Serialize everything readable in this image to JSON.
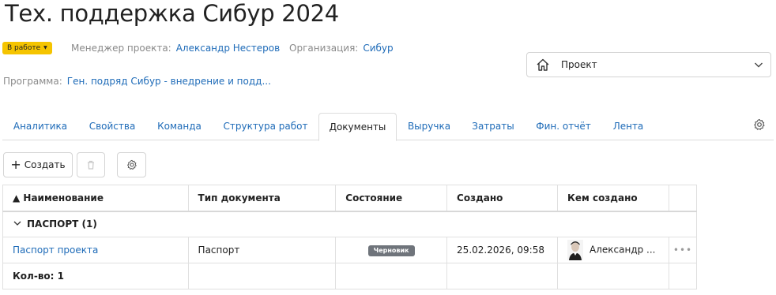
{
  "header": {
    "title": "Тех. поддержка Сибур 2024",
    "status": "В работе",
    "manager_label": "Менеджер проекта:",
    "manager_value": "Александр Нестеров",
    "org_label": "Организация:",
    "org_value": "Сибур",
    "program_label": "Программа:",
    "program_value": "Ген. подряд Сибур - внедрение и подд..."
  },
  "view_select": {
    "value": "Проект",
    "icon": "home-icon"
  },
  "tabs": [
    {
      "label": "Аналитика"
    },
    {
      "label": "Свойства"
    },
    {
      "label": "Команда"
    },
    {
      "label": "Структура работ"
    },
    {
      "label": "Документы"
    },
    {
      "label": "Выручка"
    },
    {
      "label": "Затраты"
    },
    {
      "label": "Фин. отчёт"
    },
    {
      "label": "Лента"
    }
  ],
  "active_tab": "Документы",
  "toolbar": {
    "create_label": "Создать"
  },
  "table": {
    "columns": [
      "▲ Наименование",
      "Тип документа",
      "Состояние",
      "Создано",
      "Кем создано"
    ],
    "group": {
      "label": "ПАСПОРТ (1)"
    },
    "rows": [
      {
        "name": "Паспорт проекта",
        "type": "Паспорт",
        "state": "Черновик",
        "created": "25.02.2026, 09:58",
        "author": "Александр ..."
      }
    ],
    "footer": "Кол-во: 1"
  },
  "colors": {
    "accent": "#1e6bb8",
    "status_badge": "#f5c400",
    "draft_badge": "#6f747b"
  }
}
